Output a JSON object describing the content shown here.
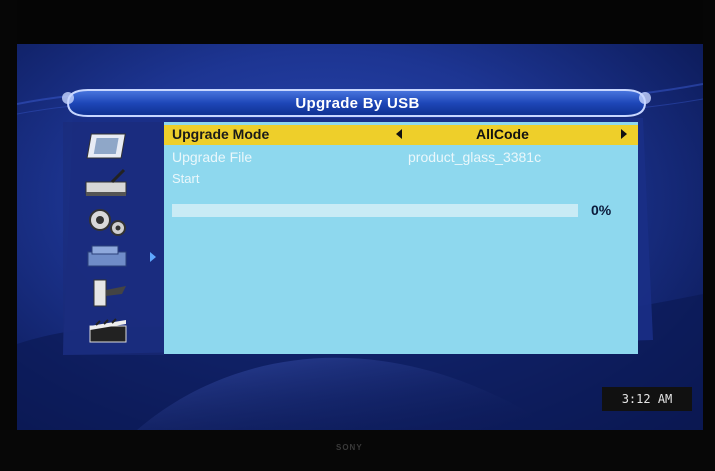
{
  "brand": "SONY",
  "dialog": {
    "title": "Upgrade By USB"
  },
  "menu": {
    "upgrade_mode": {
      "label": "Upgrade Mode",
      "value": "AllCode"
    },
    "upgrade_file": {
      "label": "Upgrade File",
      "value": "product_glass_3381c"
    },
    "start": {
      "label": "Start"
    }
  },
  "progress": {
    "value": 0,
    "text": "0%"
  },
  "sidebar": {
    "icons": [
      "picture-icon",
      "satellite-receiver-icon",
      "gears-icon",
      "tools-icon",
      "hand-tools-icon",
      "clapperboard-icon"
    ],
    "selected_index": 3
  },
  "status": {
    "clock": "3:12 AM"
  },
  "colors": {
    "highlight": "#eecf2a",
    "content_bg": "#8ed8ee",
    "screen_bg": "#1d3592"
  }
}
